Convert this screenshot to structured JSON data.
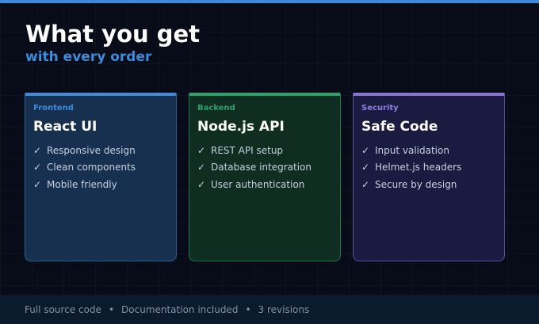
{
  "colors": {
    "accent_blue": "#3d8bdb",
    "accent_green": "#2aa06c",
    "accent_purple": "#8a73d6",
    "background": "#070c18"
  },
  "header": {
    "title": "What you get",
    "subtitle": "with every order"
  },
  "cards": [
    {
      "tag": "Frontend",
      "title": "React UI",
      "features": [
        "Responsive design",
        "Clean components",
        "Mobile friendly"
      ]
    },
    {
      "tag": "Backend",
      "title": "Node.js API",
      "features": [
        "REST API setup",
        "Database integration",
        "User authentication"
      ]
    },
    {
      "tag": "Security",
      "title": "Safe Code",
      "features": [
        "Input validation",
        "Helmet.js headers",
        "Secure by design"
      ]
    }
  ],
  "check_symbol": "✓",
  "footer": {
    "items": [
      "Full source code",
      "Documentation included",
      "3 revisions"
    ],
    "separator": "•"
  }
}
